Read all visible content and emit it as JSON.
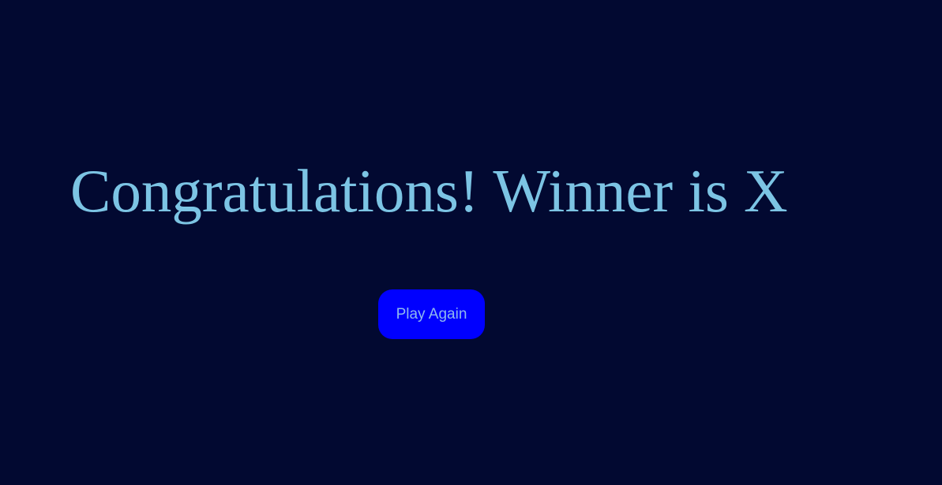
{
  "game": {
    "winner_message": "Congratulations! Winner is X",
    "play_again_label": "Play Again"
  },
  "colors": {
    "background": "#020931",
    "message_text": "#7cc4e4",
    "button_background": "#0000ff",
    "button_text": "#8fb8ef"
  }
}
